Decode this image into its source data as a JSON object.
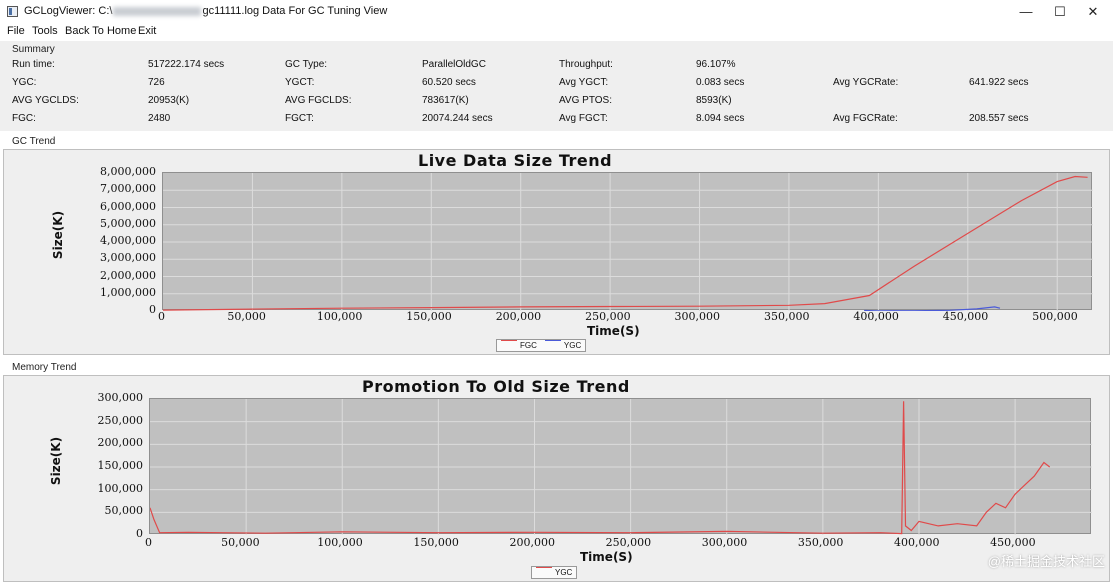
{
  "window": {
    "title_prefix": "GCLogViewer: C:\\",
    "title_suffix": "gc11111.log Data For GC Tuning View",
    "minimize": "—",
    "maximize": "☐",
    "close": "✕"
  },
  "menu": {
    "file": "File",
    "tools": "Tools",
    "back_to_home": "Back To Home",
    "exit": "Exit"
  },
  "summary": {
    "section": "Summary",
    "run_time_label": "Run time:",
    "run_time": "517222.174 secs",
    "gc_type_label": "GC Type:",
    "gc_type": "ParallelOldGC",
    "throughput_label": "Throughput:",
    "throughput": "96.107%",
    "ygc_label": "YGC:",
    "ygc": "726",
    "ygct_label": "YGCT:",
    "ygct": "60.520 secs",
    "avg_ygct_label": "Avg YGCT:",
    "avg_ygct": "0.083 secs",
    "avg_ygcrate_label": "Avg YGCRate:",
    "avg_ygcrate": "641.922 secs",
    "avg_ygclds_label": "AVG YGCLDS:",
    "avg_ygclds": "20953(K)",
    "avg_fgclds_label": "AVG FGCLDS:",
    "avg_fgclds": "783617(K)",
    "avg_ptos_label": "AVG PTOS:",
    "avg_ptos": "8593(K)",
    "fgc_label": "FGC:",
    "fgc": "2480",
    "fgct_label": "FGCT:",
    "fgct": "20074.244 secs",
    "avg_fgct_label": "Avg FGCT:",
    "avg_fgct": "8.094 secs",
    "avg_fgcrate_label": "Avg FGCRate:",
    "avg_fgcrate": "208.557 secs"
  },
  "gc_trend_label": "GC Trend",
  "memory_trend_label": "Memory Trend",
  "watermark": "@稀土掘金技术社区",
  "colors": {
    "fgc_line": "#e04a4a",
    "ygc_line": "#4a5ad8",
    "plot_bg": "#c0c0c0",
    "grid": "#dcdcdc"
  },
  "chart_data": [
    {
      "type": "line",
      "title": "Live Data Size Trend",
      "xlabel": "Time(S)",
      "ylabel": "Size(K)",
      "xlim": [
        0,
        520000
      ],
      "ylim": [
        0,
        8000000
      ],
      "x_ticks": [
        "0",
        "50,000",
        "100,000",
        "150,000",
        "200,000",
        "250,000",
        "300,000",
        "350,000",
        "400,000",
        "450,000",
        "500,000"
      ],
      "y_ticks": [
        "0",
        "1,000,000",
        "2,000,000",
        "3,000,000",
        "4,000,000",
        "5,000,000",
        "6,000,000",
        "7,000,000",
        "8,000,000"
      ],
      "grid": true,
      "legend_position": "bottom-center",
      "series": [
        {
          "name": "FGC",
          "x": [
            0,
            50000,
            100000,
            150000,
            200000,
            250000,
            300000,
            350000,
            370000,
            395000,
            420000,
            450000,
            480000,
            500000,
            510000,
            517000
          ],
          "y": [
            50000,
            110000,
            160000,
            200000,
            240000,
            260000,
            280000,
            330000,
            430000,
            900000,
            2600000,
            4500000,
            6400000,
            7500000,
            7800000,
            7750000
          ]
        },
        {
          "name": "YGC",
          "x": [
            392000,
            400000,
            420000,
            440000,
            455000,
            465000,
            468000
          ],
          "y": [
            30000,
            10000,
            20000,
            40000,
            120000,
            240000,
            160000
          ]
        }
      ]
    },
    {
      "type": "line",
      "title": "Promotion To Old Size Trend",
      "xlabel": "Time(S)",
      "ylabel": "Size(K)",
      "xlim": [
        0,
        490000
      ],
      "ylim": [
        0,
        300000
      ],
      "x_ticks": [
        "0",
        "50,000",
        "100,000",
        "150,000",
        "200,000",
        "250,000",
        "300,000",
        "350,000",
        "400,000",
        "450,000"
      ],
      "y_ticks": [
        "0",
        "50,000",
        "100,000",
        "150,000",
        "200,000",
        "250,000",
        "300,000"
      ],
      "grid": true,
      "legend_position": "bottom-center",
      "series": [
        {
          "name": "YGC",
          "x": [
            0,
            2000,
            5000,
            20000,
            60000,
            100000,
            150000,
            200000,
            250000,
            300000,
            350000,
            380000,
            391000,
            392000,
            393000,
            396000,
            400000,
            410000,
            420000,
            430000,
            435000,
            440000,
            445000,
            450000,
            455000,
            460000,
            465000,
            468000
          ],
          "y": [
            60000,
            35000,
            5000,
            6000,
            4000,
            7000,
            5000,
            6000,
            5000,
            8000,
            4000,
            5000,
            3000,
            295000,
            20000,
            10000,
            30000,
            20000,
            25000,
            20000,
            50000,
            70000,
            60000,
            90000,
            110000,
            130000,
            160000,
            150000
          ]
        }
      ]
    }
  ]
}
